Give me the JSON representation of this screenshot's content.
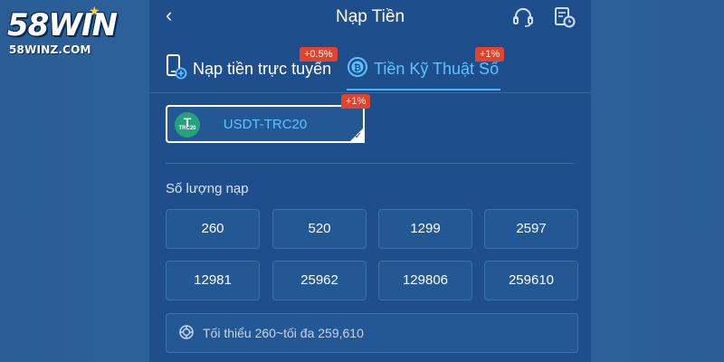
{
  "brand": {
    "logo_text": "58WIN",
    "site": "58WINZ.COM"
  },
  "header": {
    "title": "Nạp Tiền",
    "back_icon": "chevron-left-icon",
    "support_icon": "headset-icon",
    "history_icon": "history-icon"
  },
  "tabs": [
    {
      "label": "Nạp tiền trực tuyến",
      "badge": "+0.5%",
      "icon": "phone-deposit-icon",
      "active": false
    },
    {
      "label": "Tiền Kỹ Thuật Số",
      "badge": "+1%",
      "icon": "bitcoin-icon",
      "active": true
    }
  ],
  "coin": {
    "label": "USDT-TRC20",
    "badge": "+1%",
    "icon_letter": "T",
    "icon_sub": "TRC20",
    "selected": true
  },
  "amount": {
    "label": "Số lượng nạp",
    "options": [
      "260",
      "520",
      "1299",
      "2597",
      "12981",
      "25962",
      "129806",
      "259610"
    ]
  },
  "limit": {
    "text": "Tối thiểu 260~tối đa 259,610",
    "icon": "chip-icon"
  },
  "colors": {
    "panel_bg": "#1e4f8c",
    "accent": "#5fc2ff",
    "badge_red": "#e2432d",
    "tether_green": "#26a17b"
  }
}
